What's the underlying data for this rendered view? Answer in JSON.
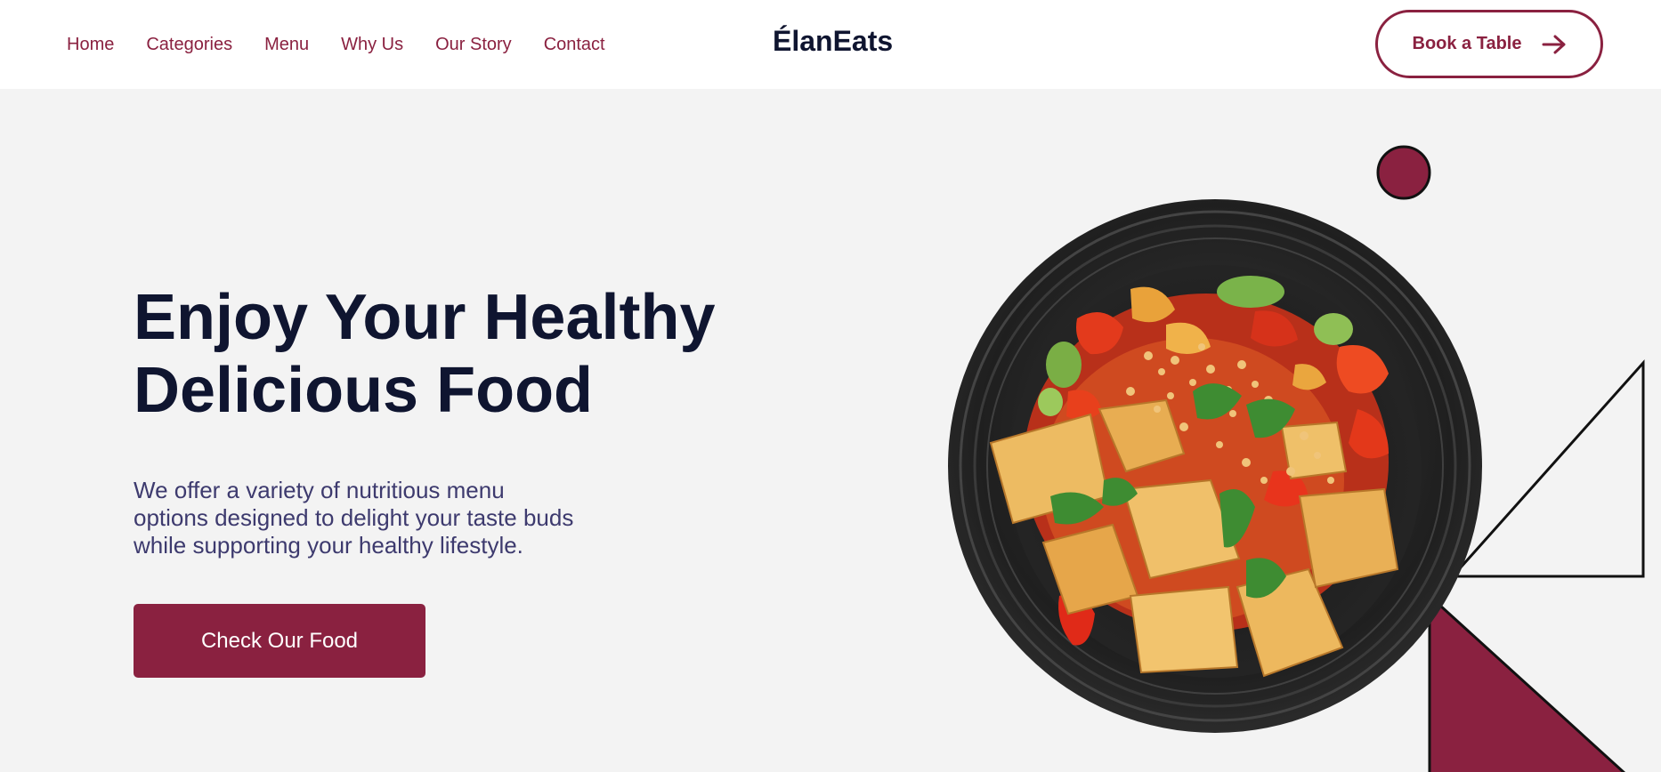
{
  "nav": {
    "items": [
      {
        "label": "Home"
      },
      {
        "label": "Categories"
      },
      {
        "label": "Menu"
      },
      {
        "label": "Why Us"
      },
      {
        "label": "Our Story"
      },
      {
        "label": "Contact"
      }
    ]
  },
  "brand": {
    "name": "ÉlanEats"
  },
  "header": {
    "book_label": "Book a Table",
    "book_icon": "arrow-right-icon"
  },
  "hero": {
    "headline_line1": "Enjoy Your Healthy",
    "headline_line2": "Delicious Food",
    "description_line1": "We offer a variety of nutritious menu",
    "description_line2": "options designed to delight your taste buds",
    "description_line3": "while supporting your healthy lifestyle.",
    "cta_label": "Check Our Food",
    "image": "food-bowl-image"
  },
  "colors": {
    "accent": "#8a2140",
    "heading": "#0f1530",
    "body_text": "#3d3a6e",
    "background": "#f3f3f3",
    "header_bg": "#ffffff"
  }
}
